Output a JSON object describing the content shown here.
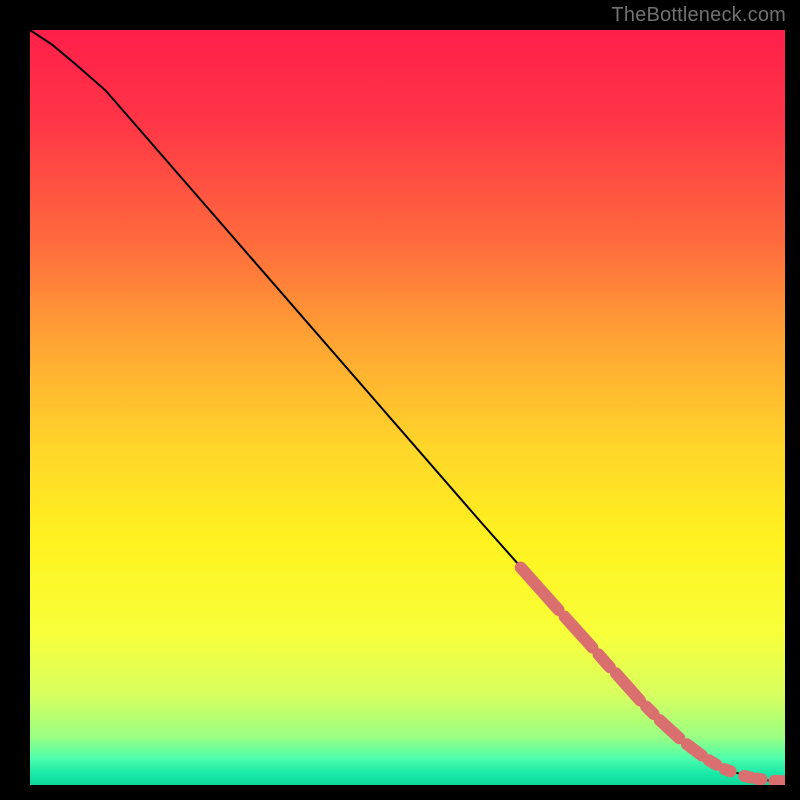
{
  "watermark": "TheBottleneck.com",
  "colors": {
    "black": "#000000",
    "curve": "#000000",
    "marker_fill": "#d96f6e",
    "marker_stroke": "#c95d5c"
  },
  "chart_data": {
    "type": "line",
    "title": "",
    "xlabel": "",
    "ylabel": "",
    "xlim": [
      0,
      100
    ],
    "ylim": [
      0,
      100
    ],
    "grid": false,
    "legend": false,
    "gradient_stops": [
      {
        "offset": 0.0,
        "color": "#ff1f4a"
      },
      {
        "offset": 0.12,
        "color": "#ff3547"
      },
      {
        "offset": 0.28,
        "color": "#ff6a3d"
      },
      {
        "offset": 0.42,
        "color": "#ffa733"
      },
      {
        "offset": 0.55,
        "color": "#ffd52a"
      },
      {
        "offset": 0.68,
        "color": "#fff31f"
      },
      {
        "offset": 0.8,
        "color": "#f7ff3a"
      },
      {
        "offset": 0.88,
        "color": "#d8ff5f"
      },
      {
        "offset": 0.935,
        "color": "#9cff82"
      },
      {
        "offset": 0.965,
        "color": "#4dfdab"
      },
      {
        "offset": 0.985,
        "color": "#18e8a8"
      },
      {
        "offset": 1.0,
        "color": "#0fd79a"
      }
    ],
    "curve": {
      "name": "bottleneck-curve",
      "x": [
        0,
        3,
        6,
        10,
        20,
        30,
        40,
        50,
        60,
        68,
        76,
        82,
        87,
        90,
        93,
        95.5,
        97,
        98.5,
        100
      ],
      "y": [
        100,
        98,
        95.5,
        92,
        80.5,
        69,
        57.5,
        46,
        34.5,
        25.5,
        16.5,
        10,
        5.5,
        3.3,
        1.8,
        1.0,
        0.7,
        0.55,
        0.5
      ]
    },
    "marker_segments": [
      {
        "x0": 65.0,
        "y0": 28.8,
        "x1": 70.0,
        "y1": 23.2
      },
      {
        "x0": 70.8,
        "y0": 22.3,
        "x1": 74.5,
        "y1": 18.2
      },
      {
        "x0": 75.3,
        "y0": 17.3,
        "x1": 76.8,
        "y1": 15.6
      },
      {
        "x0": 77.6,
        "y0": 14.8,
        "x1": 80.8,
        "y1": 11.2
      },
      {
        "x0": 81.6,
        "y0": 10.4,
        "x1": 82.6,
        "y1": 9.4
      },
      {
        "x0": 83.4,
        "y0": 8.6,
        "x1": 86.0,
        "y1": 6.2
      },
      {
        "x0": 87.0,
        "y0": 5.4,
        "x1": 89.0,
        "y1": 3.9
      },
      {
        "x0": 89.9,
        "y0": 3.3,
        "x1": 90.9,
        "y1": 2.7
      },
      {
        "x0": 92.0,
        "y0": 2.1,
        "x1": 92.8,
        "y1": 1.8
      },
      {
        "x0": 94.6,
        "y0": 1.2,
        "x1": 95.4,
        "y1": 1.0
      },
      {
        "x0": 96.2,
        "y0": 0.85,
        "x1": 96.9,
        "y1": 0.75
      },
      {
        "x0": 98.6,
        "y0": 0.55,
        "x1": 100.0,
        "y1": 0.5
      }
    ]
  }
}
